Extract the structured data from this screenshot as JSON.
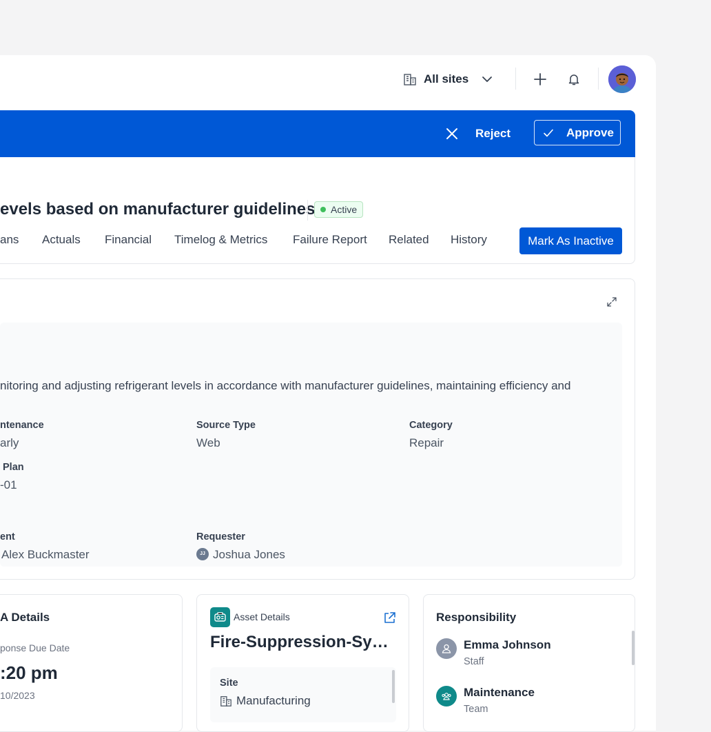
{
  "topbar": {
    "site_selector_label": "All sites",
    "icons": [
      "building-icon",
      "chevron-down-icon",
      "plus-icon",
      "bell-icon",
      "avatar"
    ]
  },
  "banner": {
    "reject_label": "Reject",
    "approve_label": "Approve",
    "color": "#0058d6"
  },
  "work_order": {
    "title": "evels based on manufacturer guidelines.",
    "status": "Active",
    "tabs": [
      "ans",
      "Actuals",
      "Financial",
      "Timelog & Metrics",
      "Failure Report",
      "Related",
      "History"
    ],
    "mark_inactive_label": "Mark As Inactive"
  },
  "details": {
    "description": "nitoring and adjusting refrigerant levels in accordance with manufacturer guidelines, maintaining efficiency and",
    "fields": {
      "maintenance_label": "ntenance",
      "maintenance_value": "arly",
      "source_type_label": "Source Type",
      "source_type_value": "Web",
      "category_label": "Category",
      "category_value": "Repair",
      "plan_label": "Plan",
      "plan_value": "-01",
      "assignment_label": "ent",
      "assignment_value": "Alex Buckmaster",
      "requester_label": "Requester",
      "requester_value": "Joshua Jones",
      "requester_initials": "JJ"
    }
  },
  "sla_card": {
    "title": "A Details",
    "due_label": "ponse Due Date",
    "time": ":20 pm",
    "date": "10/2023"
  },
  "asset_card": {
    "header_label": "Asset Details",
    "asset_name": "Fire-Suppression-System",
    "site_label": "Site",
    "site_value": "Manufacturing"
  },
  "responsibility_card": {
    "title": "Responsibility",
    "people": [
      {
        "name": "Emma Johnson",
        "role": "Staff"
      },
      {
        "name": "Maintenance",
        "role": "Team"
      }
    ]
  },
  "colors": {
    "primary": "#0058d6",
    "active_green": "#3fbf5c",
    "teal": "#0f8a8a"
  }
}
